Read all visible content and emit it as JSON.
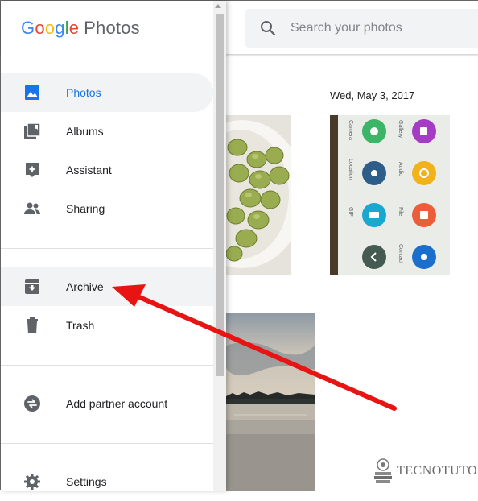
{
  "app": {
    "logo_word": [
      "G",
      "o",
      "o",
      "g",
      "l",
      "e"
    ],
    "product_name": "Photos"
  },
  "search": {
    "placeholder": "Search your photos",
    "icon": "search-icon"
  },
  "timeline": {
    "date_label": "Wed, May 3, 2017"
  },
  "phone_screenshot_labels": [
    "Camera",
    "Gallery",
    "Location",
    "Audio",
    "GIF",
    "File",
    "Contact"
  ],
  "nav": {
    "items": [
      {
        "label": "Photos",
        "icon": "photos-icon",
        "active": true
      },
      {
        "label": "Albums",
        "icon": "albums-icon"
      },
      {
        "label": "Assistant",
        "icon": "assistant-icon"
      },
      {
        "label": "Sharing",
        "icon": "sharing-icon"
      },
      {
        "label": "Archive",
        "icon": "archive-icon",
        "highlighted": true
      },
      {
        "label": "Trash",
        "icon": "trash-icon"
      },
      {
        "label": "Add partner account",
        "icon": "partner-sharing-icon"
      },
      {
        "label": "Settings",
        "icon": "settings-icon"
      }
    ]
  },
  "annotation": {
    "arrow_color": "#e81414",
    "points_to": "Archive"
  },
  "watermark": {
    "text": "TECNOTUTO"
  },
  "colors": {
    "accent_blue": "#1a73e8",
    "icon_gray": "#5f6368",
    "drawer_highlight": "#f1f3f4"
  }
}
